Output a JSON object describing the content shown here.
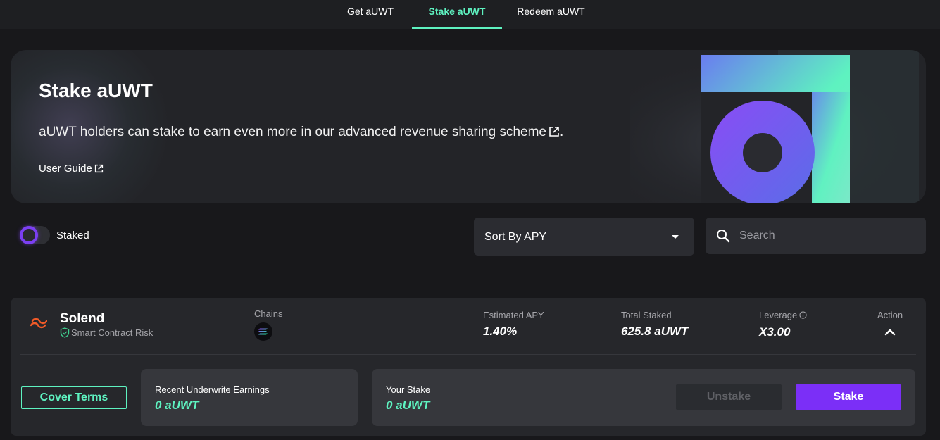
{
  "nav": {
    "tabs": [
      {
        "label": "Get aUWT",
        "active": false
      },
      {
        "label": "Stake aUWT",
        "active": true
      },
      {
        "label": "Redeem aUWT",
        "active": false
      }
    ]
  },
  "hero": {
    "title": "Stake aUWT",
    "description": "aUWT holders can stake to earn even more in our advanced revenue sharing scheme",
    "description_suffix": ".",
    "guide_link": "User Guide"
  },
  "filters": {
    "staked_toggle_label": "Staked",
    "staked_toggle_on": false,
    "sort_label": "Sort By APY",
    "search_placeholder": "Search"
  },
  "pool": {
    "name": "Solend",
    "risk_type": "Smart Contract Risk",
    "chains_label": "Chains",
    "chain_icons": [
      "solana-icon"
    ],
    "apy_label": "Estimated APY",
    "apy_value": "1.40%",
    "total_staked_label": "Total Staked",
    "total_staked_value": "625.8 aUWT",
    "leverage_label": "Leverage",
    "leverage_value": "X3.00",
    "action_label": "Action",
    "cover_terms_label": "Cover Terms",
    "earnings_label": "Recent Underwrite Earnings",
    "earnings_value": "0 aUWT",
    "your_stake_label": "Your Stake",
    "your_stake_value": "0 aUWT",
    "unstake_label": "Unstake",
    "stake_label": "Stake"
  },
  "colors": {
    "accent": "#5ef2c0",
    "primary_button": "#7b2ff7",
    "background": "#18181b",
    "card": "#26272b"
  }
}
